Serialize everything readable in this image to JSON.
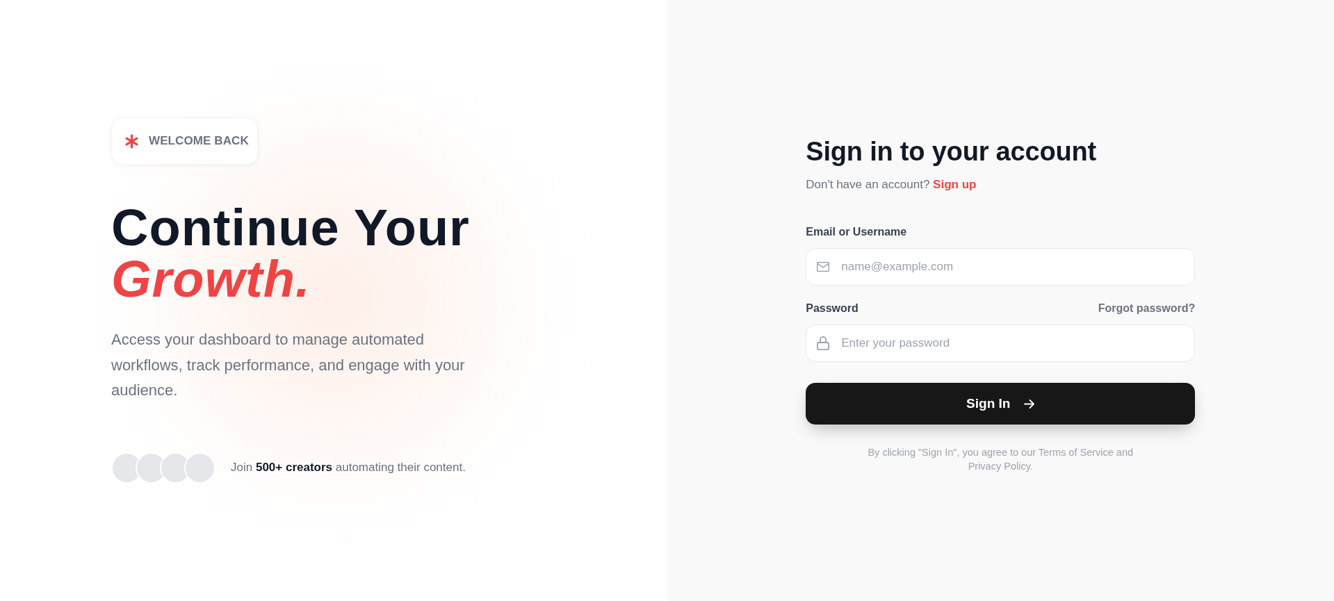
{
  "hero": {
    "badge": "WELCOME BACK",
    "headline": "Continue Your",
    "headline_accent": "Growth.",
    "description": "Access your dashboard to manage automated workflows, track performance, and engage with your audience.",
    "social_proof": "Join **500+ creators** automating their content."
  },
  "form": {
    "title": "Sign in to your account",
    "signup_prompt": "Don't have an account?",
    "signup_link": "Sign up",
    "fields": [
      {
        "kind": "email",
        "label": "Email or Username",
        "placeholder": "name@example.com"
      },
      {
        "kind": "password",
        "label": "Password",
        "link": "Forgot password?",
        "placeholder": "Enter your password"
      }
    ],
    "submit": "Sign In",
    "terms": "By clicking \"Sign In\", you agree to our Terms of Service and Privacy Policy."
  }
}
